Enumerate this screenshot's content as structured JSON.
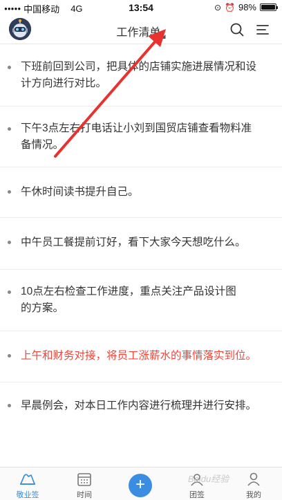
{
  "status_bar": {
    "carrier": "中国移动",
    "network": "4G",
    "time": "13:54",
    "battery": "98%",
    "battery_level": 0.98
  },
  "header": {
    "title": "工作清单",
    "avatar_icon": "robot-avatar",
    "search_icon": "search-icon",
    "menu_icon": "menu-icon"
  },
  "tasks": [
    {
      "text_line1": "下班前回到公司，把具体的店铺实施进展情况和设",
      "text_line2": "计方向进行对比。",
      "highlight": false
    },
    {
      "text_line1": "下午3点左右打电话让小刘到国贸店铺查看物料准",
      "text_line2": "备情况。",
      "highlight": false
    },
    {
      "text_line1": "午休时间读书提升自己。",
      "text_line2": "",
      "highlight": false
    },
    {
      "text_line1": "中午员工餐提前订好，看下大家今天想吃什么。",
      "text_line2": "",
      "highlight": false
    },
    {
      "text_line1": "10点左右检查工作进度，重点关注产品设计图",
      "text_line2": "的方案。",
      "highlight": false
    },
    {
      "text_line1": "上午和财务对接，将员工涨薪水的事情落实到位。",
      "text_line2": "",
      "highlight": true
    },
    {
      "text_line1": "早晨例会，对本日工作内容进行梳理并进行安排。",
      "text_line2": "",
      "highlight": false
    }
  ],
  "colors": {
    "accent": "#3a8de0",
    "highlight_text": "#f44336",
    "annotation_arrow": "#e8322f"
  },
  "tabbar": {
    "tabs": [
      {
        "label": "敬业签",
        "icon": "note-icon",
        "active": true
      },
      {
        "label": "时间",
        "icon": "calendar-icon",
        "active": false
      },
      {
        "label": "团签",
        "icon": "team-icon",
        "active": false
      },
      {
        "label": "我的",
        "icon": "user-icon",
        "active": false
      }
    ],
    "add_button": "+",
    "watermark": "Baidu经验"
  }
}
